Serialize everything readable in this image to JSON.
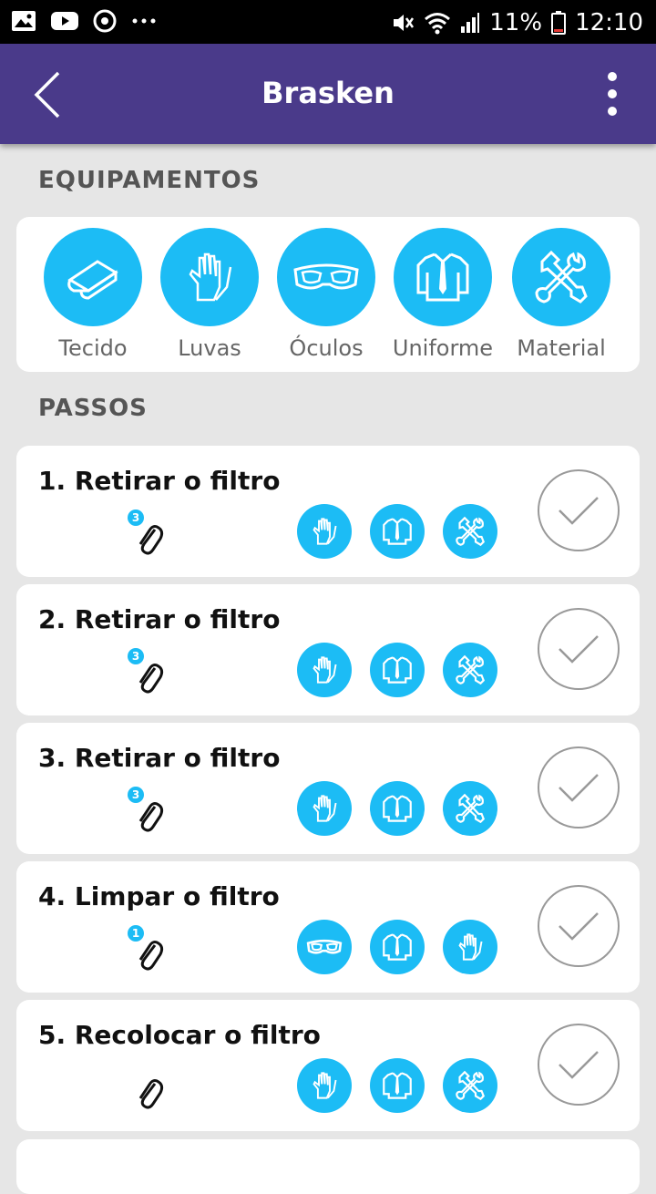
{
  "status_bar": {
    "battery": "11%",
    "time": "12:10"
  },
  "app_bar": {
    "title": "Brasken"
  },
  "sections": {
    "equipment_title": "EQUIPAMENTOS",
    "steps_title": "PASSOS"
  },
  "equipment": [
    {
      "label": "Tecido",
      "icon": "fabric-icon"
    },
    {
      "label": "Luvas",
      "icon": "gloves-icon"
    },
    {
      "label": "Óculos",
      "icon": "goggles-icon"
    },
    {
      "label": "Uniforme",
      "icon": "uniform-icon"
    },
    {
      "label": "Material",
      "icon": "tools-icon"
    }
  ],
  "steps": [
    {
      "title": "1. Retirar o filtro",
      "attachments": "3",
      "icons": [
        "gloves-icon",
        "uniform-icon",
        "tools-icon"
      ]
    },
    {
      "title": "2. Retirar o filtro",
      "attachments": "3",
      "icons": [
        "gloves-icon",
        "uniform-icon",
        "tools-icon"
      ]
    },
    {
      "title": "3. Retirar o filtro",
      "attachments": "3",
      "icons": [
        "gloves-icon",
        "uniform-icon",
        "tools-icon"
      ]
    },
    {
      "title": "4. Limpar o filtro",
      "attachments": "1",
      "icons": [
        "goggles-icon",
        "uniform-icon",
        "gloves-icon"
      ]
    },
    {
      "title": "5. Recolocar o filtro",
      "attachments": "",
      "icons": [
        "gloves-icon",
        "uniform-icon",
        "tools-icon"
      ]
    }
  ],
  "colors": {
    "app_bar": "#4a3a8a",
    "accent": "#1cbcf5",
    "background": "#e6e6e6"
  }
}
